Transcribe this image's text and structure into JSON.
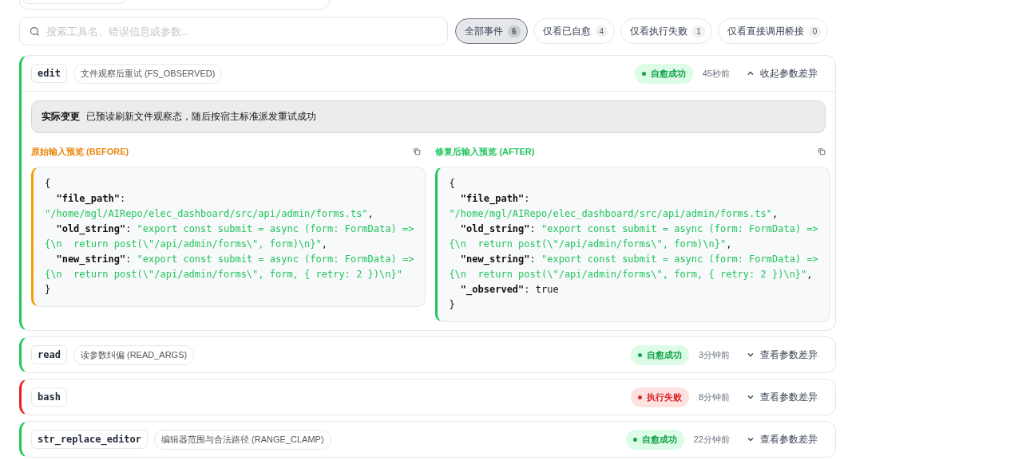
{
  "search": {
    "placeholder": "搜索工具名、错误信息或参数..."
  },
  "filters": [
    {
      "label": "全部事件",
      "count": "6",
      "selected": true
    },
    {
      "label": "仅看已自愈",
      "count": "4",
      "selected": false
    },
    {
      "label": "仅看执行失败",
      "count": "1",
      "selected": false
    },
    {
      "label": "仅看直接调用桥接",
      "count": "0",
      "selected": false
    }
  ],
  "events": [
    {
      "tool": "edit",
      "strategy": "文件观察后重试 (FS_OBSERVED)",
      "status": "自愈成功",
      "kind": "healed",
      "time": "45秒前",
      "toggle": "收起参数差异",
      "expanded": true,
      "change": {
        "label": "实际变更",
        "text": "已预读刷新文件观察态，随后按宿主标准派发重试成功"
      },
      "panes": [
        {
          "title": "原始输入预览 (BEFORE)",
          "kind": "before",
          "lines": [
            [
              {
                "kind": "plain",
                "text": "{"
              }
            ],
            [
              {
                "kind": "key",
                "text": "  \"file_path\""
              },
              {
                "kind": "plain",
                "text": ":"
              }
            ],
            [
              {
                "kind": "string",
                "text": "\"/home/mgl/AIRepo/elec_dashboard/src/api/admin/forms.ts\""
              },
              {
                "kind": "plain",
                "text": ","
              }
            ],
            [
              {
                "kind": "key",
                "text": "  \"old_string\""
              },
              {
                "kind": "plain",
                "text": ": "
              },
              {
                "kind": "string",
                "text": "\"export const submit = async (form: FormData) =>"
              }
            ],
            [
              {
                "kind": "string",
                "text": "{\\n  return post(\\\"/api/admin/forms\\\", form)\\n}\""
              },
              {
                "kind": "plain",
                "text": ","
              }
            ],
            [
              {
                "kind": "key",
                "text": "  \"new_string\""
              },
              {
                "kind": "plain",
                "text": ": "
              },
              {
                "kind": "string",
                "text": "\"export const submit = async (form: FormData) =>"
              }
            ],
            [
              {
                "kind": "string",
                "text": "{\\n  return post(\\\"/api/admin/forms\\\", form, { retry: 2 })\\n}\""
              }
            ],
            [
              {
                "kind": "plain",
                "text": "}"
              }
            ]
          ]
        },
        {
          "title": "修复后输入预览 (AFTER)",
          "kind": "after",
          "lines": [
            [
              {
                "kind": "plain",
                "text": "{"
              }
            ],
            [
              {
                "kind": "key",
                "text": "  \"file_path\""
              },
              {
                "kind": "plain",
                "text": ":"
              }
            ],
            [
              {
                "kind": "string",
                "text": "\"/home/mgl/AIRepo/elec_dashboard/src/api/admin/forms.ts\""
              },
              {
                "kind": "plain",
                "text": ","
              }
            ],
            [
              {
                "kind": "key",
                "text": "  \"old_string\""
              },
              {
                "kind": "plain",
                "text": ": "
              },
              {
                "kind": "string",
                "text": "\"export const submit = async (form: FormData) =>"
              }
            ],
            [
              {
                "kind": "string",
                "text": "{\\n  return post(\\\"/api/admin/forms\\\", form)\\n}\""
              },
              {
                "kind": "plain",
                "text": ","
              }
            ],
            [
              {
                "kind": "key",
                "text": "  \"new_string\""
              },
              {
                "kind": "plain",
                "text": ": "
              },
              {
                "kind": "string",
                "text": "\"export const submit = async (form: FormData) =>"
              }
            ],
            [
              {
                "kind": "string",
                "text": "{\\n  return post(\\\"/api/admin/forms\\\", form, { retry: 2 })\\n}\""
              },
              {
                "kind": "plain",
                "text": ","
              }
            ],
            [
              {
                "kind": "key",
                "text": "  \"_observed\""
              },
              {
                "kind": "plain",
                "text": ": true"
              }
            ],
            [
              {
                "kind": "plain",
                "text": "}"
              }
            ]
          ]
        }
      ]
    },
    {
      "tool": "read",
      "strategy": "读参数纠偏 (READ_ARGS)",
      "status": "自愈成功",
      "kind": "healed",
      "time": "3分钟前",
      "toggle": "查看参数差异",
      "expanded": false
    },
    {
      "tool": "bash",
      "status": "执行失败",
      "kind": "failed",
      "time": "8分钟前",
      "toggle": "查看参数差异",
      "expanded": false
    },
    {
      "tool": "str_replace_editor",
      "strategy": "编辑器范围与合法路径 (RANGE_CLAMP)",
      "status": "自愈成功",
      "kind": "healed",
      "time": "22分钟前",
      "toggle": "查看参数差异",
      "expanded": false
    }
  ]
}
